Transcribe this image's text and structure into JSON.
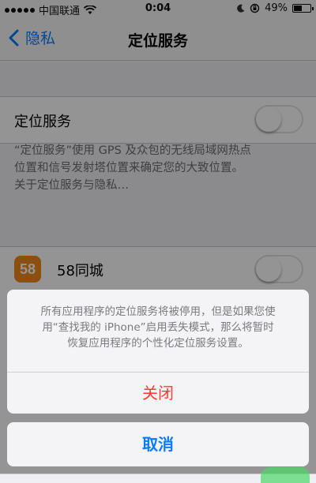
{
  "status_bar": {
    "carrier": "中国联通",
    "time": "0:04",
    "battery_percent": "49%",
    "battery_level": 0.49
  },
  "nav": {
    "back_label": "隐私",
    "title": "定位服务"
  },
  "location_services": {
    "label": "定位服务",
    "toggle_on": false,
    "description_line1": "“定位服务”使用 GPS 及众包的无线局域网热点",
    "description_line2": "位置和信号发射塔位置来确定您的大致位置。",
    "about_link": "关于定位服务与隐私…"
  },
  "apps": [
    {
      "icon_text": "58",
      "name": "58同城",
      "toggle_on": false
    }
  ],
  "action_sheet": {
    "message_line1": "所有应用程序的定位服务将被停用，但是如果您使",
    "message_line2": "用“查找我的 iPhone”启用丢失模式，那么将暂时",
    "message_line3": "恢复应用程序的个性化定位服务设置。",
    "confirm_label": "关闭",
    "cancel_label": "取消"
  },
  "colors": {
    "accent_blue": "#0a7aff",
    "destructive_red": "#ff3b30",
    "app_icon_orange": "#f08a1d",
    "toggle_on_green": "#4cd964"
  }
}
